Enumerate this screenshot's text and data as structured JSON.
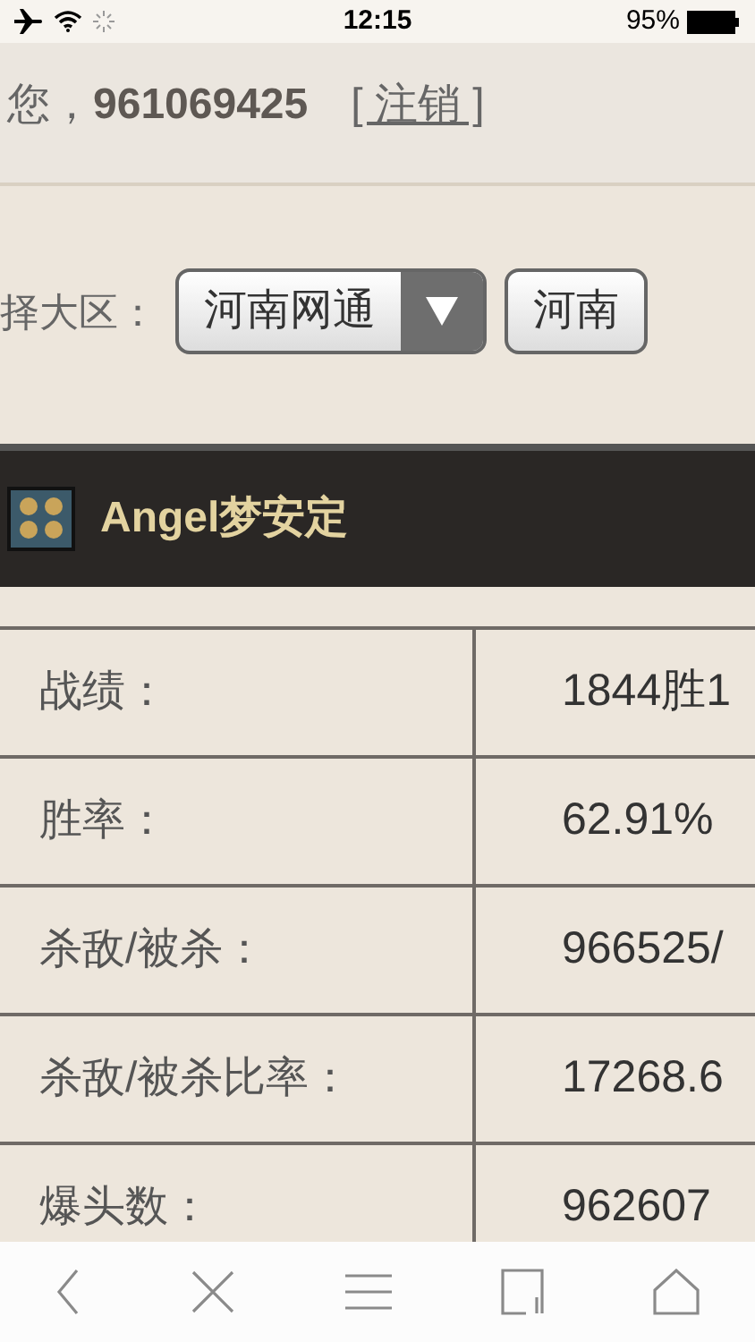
{
  "status_bar": {
    "time": "12:15",
    "battery": "95%"
  },
  "header": {
    "greeting": "您，",
    "user": "961069425",
    "logout": "[ 注销 ]"
  },
  "region": {
    "label": "择大区：",
    "selects": [
      {
        "value": "河南网通",
        "open_button": true
      },
      {
        "value": "河南",
        "open_button": false
      }
    ]
  },
  "player": {
    "name": "Angel梦安定"
  },
  "stats": [
    {
      "label": "战绩：",
      "value": "1844胜1"
    },
    {
      "label": "胜率：",
      "value": "62.91%"
    },
    {
      "label": "杀敌/被杀：",
      "value": "966525/"
    },
    {
      "label": "杀敌/被杀比率：",
      "value": "17268.6"
    },
    {
      "label": "爆头数：",
      "value": "962607"
    }
  ]
}
